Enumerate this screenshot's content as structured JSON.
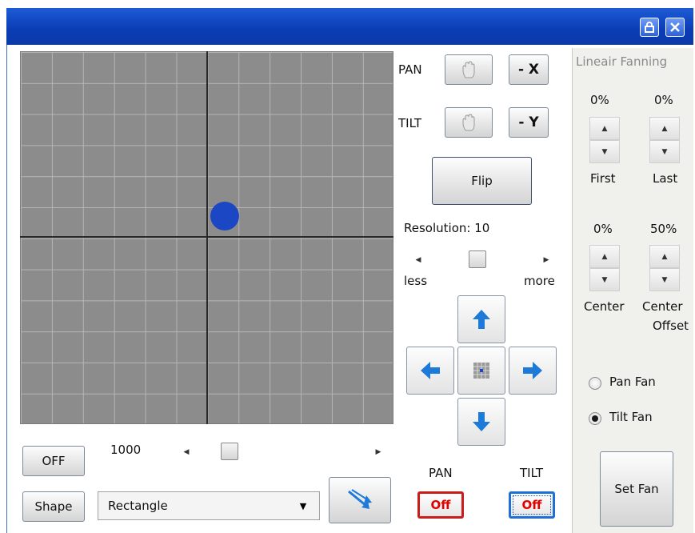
{
  "titlebar": {
    "lock_icon": "lock-icon",
    "close_icon": "close-icon"
  },
  "grid": {
    "dot_color": "#1b47c4"
  },
  "pan_label": "PAN",
  "tilt_label": "TILT",
  "invert_x": "- X",
  "invert_y": "- Y",
  "flip_label": "Flip",
  "resolution": {
    "label": "Resolution: 10",
    "less": "less",
    "more": "more"
  },
  "bottom": {
    "off_label": "OFF",
    "speed_value": "1000",
    "shape_label": "Shape",
    "shape_selected": "Rectangle"
  },
  "enable": {
    "pan_title": "PAN",
    "tilt_title": "TILT",
    "pan_state": "Off",
    "tilt_state": "Off"
  },
  "fanning": {
    "title": "Lineair Fanning",
    "first_value": "0%",
    "last_value": "0%",
    "first_label": "First",
    "last_label": "Last",
    "center_value": "0%",
    "offset_value": "50%",
    "center_label": "Center",
    "offset_label_1": "Center",
    "offset_label_2": "Offset",
    "pan_fan": "Pan Fan",
    "tilt_fan": "Tilt Fan",
    "selected_fan": "Tilt Fan",
    "set_fan": "Set Fan"
  }
}
